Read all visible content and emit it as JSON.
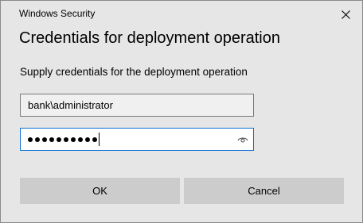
{
  "window": {
    "title": "Windows Security"
  },
  "dialog": {
    "heading": "Credentials for deployment operation",
    "description": "Supply credentials for the deployment operation",
    "username_value": "bank\\administrator",
    "password_mask_count": 10
  },
  "buttons": {
    "ok_label": "OK",
    "cancel_label": "Cancel"
  },
  "icons": {
    "close": "close-icon",
    "reveal": "eye-icon"
  },
  "colors": {
    "accent": "#0a6fd6",
    "background": "#e6e6e6",
    "button": "#cccccc"
  }
}
